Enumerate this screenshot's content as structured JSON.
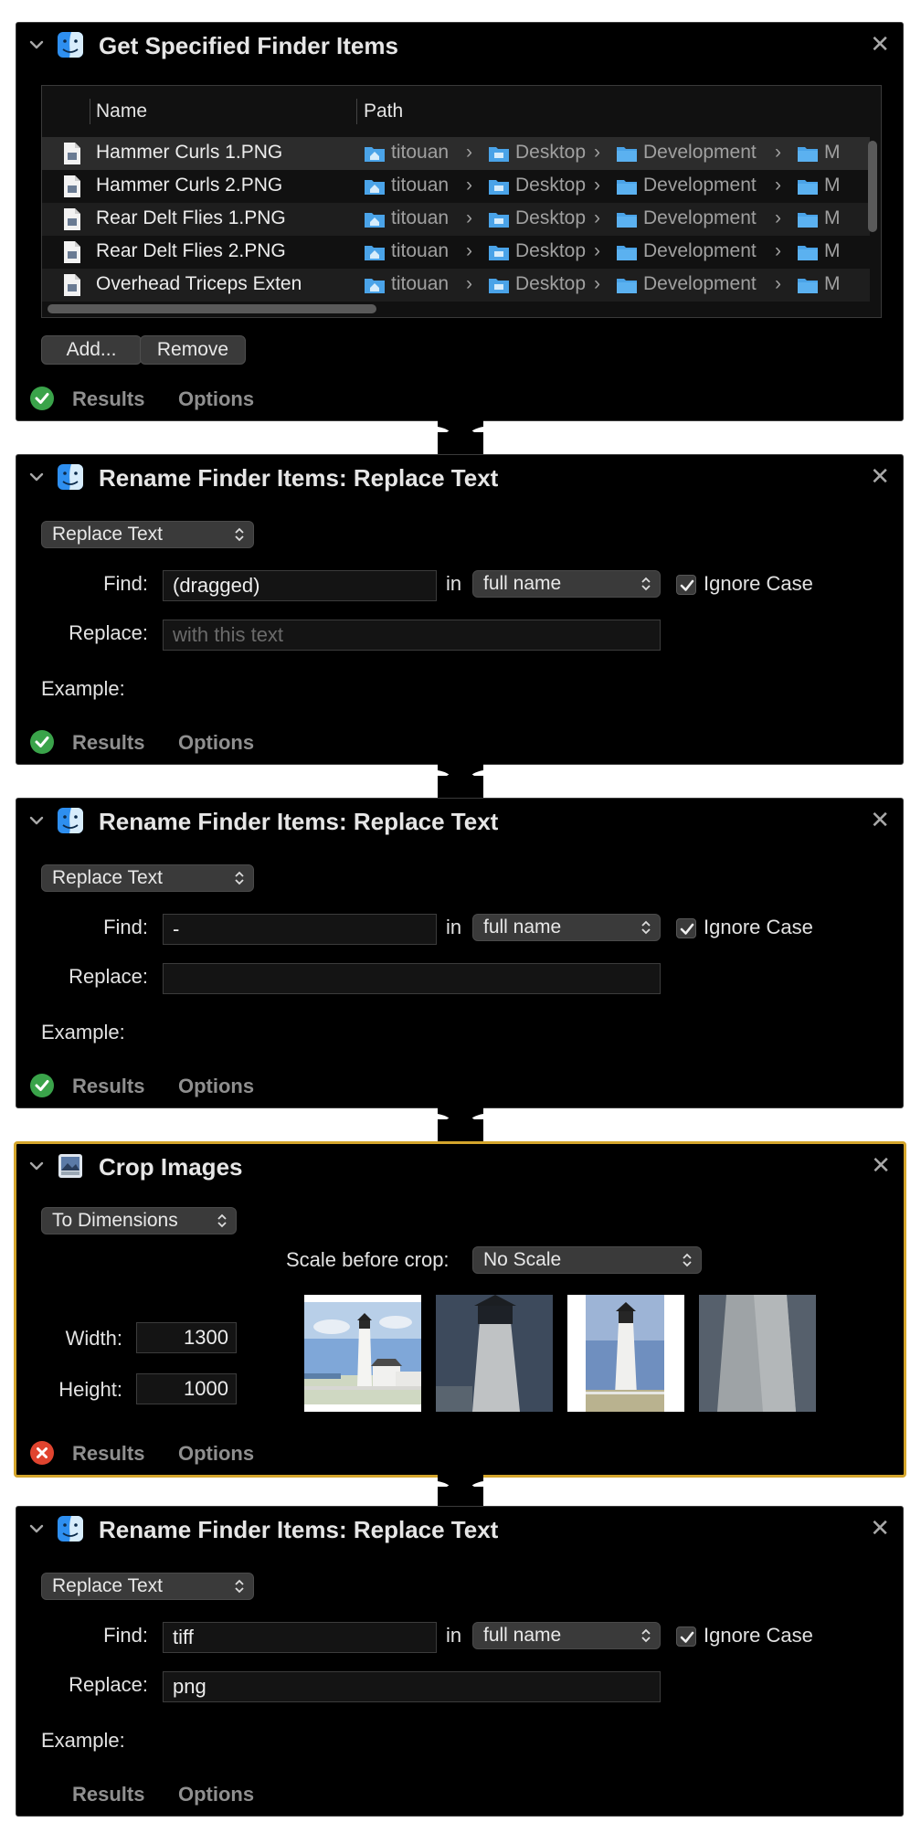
{
  "panel1": {
    "title": "Get Specified Finder Items",
    "columns": {
      "name": "Name",
      "path": "Path"
    },
    "files": [
      "Hammer Curls 1.PNG",
      "Hammer Curls 2.PNG",
      "Rear Delt Flies 1.PNG",
      "Rear Delt Flies 2.PNG",
      "Overhead Triceps Extensi"
    ],
    "path": {
      "user": "titouan",
      "desktop": "Desktop",
      "dev": "Development",
      "last": "M"
    },
    "add": "Add...",
    "remove": "Remove",
    "results": "Results",
    "options": "Options"
  },
  "panel2": {
    "title": "Rename Finder Items: Replace Text",
    "mode": "Replace Text",
    "find_label": "Find:",
    "find_value": "(dragged)",
    "in_label": "in",
    "scope": "full name",
    "ignore_case": "Ignore Case",
    "replace_label": "Replace:",
    "replace_placeholder": "with this text",
    "example_label": "Example:",
    "results": "Results",
    "options": "Options"
  },
  "panel3": {
    "title": "Rename Finder Items: Replace Text",
    "mode": "Replace Text",
    "find_label": "Find:",
    "find_value": "-",
    "in_label": "in",
    "scope": "full name",
    "ignore_case": "Ignore Case",
    "replace_label": "Replace:",
    "example_label": "Example:",
    "results": "Results",
    "options": "Options"
  },
  "panel4": {
    "title": "Crop Images",
    "mode": "To Dimensions",
    "scale_label": "Scale before crop:",
    "scale_value": "No Scale",
    "width_label": "Width:",
    "width_value": "1300",
    "height_label": "Height:",
    "height_value": "1000",
    "results": "Results",
    "options": "Options"
  },
  "panel5": {
    "title": "Rename Finder Items: Replace Text",
    "mode": "Replace Text",
    "find_label": "Find:",
    "find_value": "tiff",
    "in_label": "in",
    "scope": "full name",
    "ignore_case": "Ignore Case",
    "replace_label": "Replace:",
    "replace_value": "png",
    "example_label": "Example:",
    "results": "Results",
    "options": "Options"
  },
  "colors": {
    "selected_border": "#d4a52c",
    "success": "#3aa34a",
    "error": "#e0442f"
  }
}
